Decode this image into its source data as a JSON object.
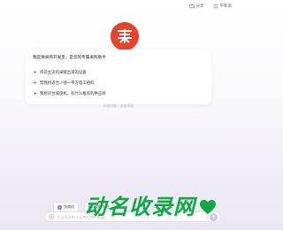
{
  "header": {
    "share_label": "分享",
    "menu_label": "平和渐"
  },
  "logo": {
    "glyph": "采",
    "color": "#e8432c"
  },
  "intro": {
    "greeting": "我是要采购开发宝，是您的专属采购助手",
    "suggestions": [
      {
        "label": "目前主流的采暖出来的设备",
        "icon": "spark-icon"
      },
      {
        "label": "帮我找适合少钱一平方电工拍料",
        "icon": "spark-icon"
      },
      {
        "label": "我想买台坡旋机，有什么推荐的供应商",
        "icon": "spark-icon"
      }
    ]
  },
  "hint": "问我问题，说说我家",
  "chips": [
    {
      "label": "找商机",
      "icon": "sparkle-icon"
    },
    {
      "label": "找配先图",
      "icon": "image-icon"
    }
  ],
  "input": {
    "placeholder": "点击您采购什么供应商的联盟",
    "value": ""
  },
  "watermark": {
    "text": "动名收录网"
  },
  "colors": {
    "accent": "#e8432c",
    "watermark": "#10a845",
    "send": "#cbc4e2"
  }
}
